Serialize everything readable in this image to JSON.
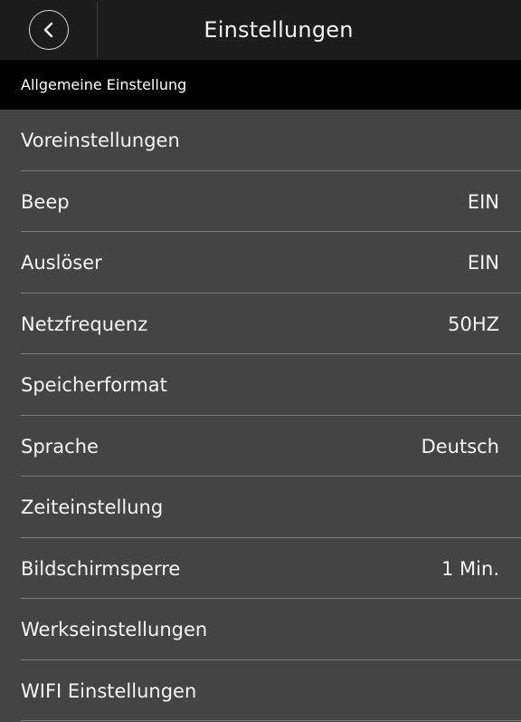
{
  "header": {
    "title": "Einstellungen",
    "back_icon": "chevron-left-icon"
  },
  "section": {
    "title": "Allgemeine Einstellung"
  },
  "settings": [
    {
      "label": "Voreinstellungen",
      "value": ""
    },
    {
      "label": "Beep",
      "value": "EIN"
    },
    {
      "label": "Auslöser",
      "value": "EIN"
    },
    {
      "label": "Netzfrequenz",
      "value": "50HZ"
    },
    {
      "label": "Speicherformat",
      "value": ""
    },
    {
      "label": "Sprache",
      "value": "Deutsch"
    },
    {
      "label": "Zeiteinstellung",
      "value": ""
    },
    {
      "label": "Bildschirmsperre",
      "value": "1 Min."
    },
    {
      "label": "Werkseinstellungen",
      "value": ""
    },
    {
      "label": "WIFI Einstellungen",
      "value": ""
    }
  ],
  "colors": {
    "header_bg": "#1c1c1c",
    "section_bg": "#000000",
    "list_bg": "#444444",
    "divider": "#7a7a7a",
    "text": "#f4f4f4"
  }
}
